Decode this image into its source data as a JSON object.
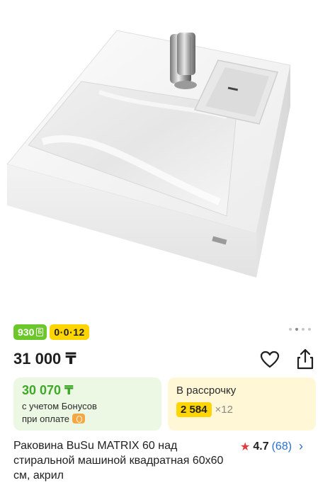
{
  "badges": {
    "bonus_value": "930",
    "bonus_symbol": "Б",
    "installment": "0·0·12"
  },
  "gallery": {
    "image_subject": "washbasin-product-photo",
    "dots_count": 4,
    "active_dot": 2
  },
  "price": {
    "main": "31 000 ₸"
  },
  "bonus_card": {
    "price": "30 070 ₸",
    "note_line1": "с учетом Бонусов",
    "note_line2": "при оплате"
  },
  "installment_card": {
    "label": "В рассрочку",
    "amount": "2 584",
    "months": "×12"
  },
  "product": {
    "title": "Раковина BuSu MATRIX 60 над стиральной машиной квадратная 60х60 см, акрил",
    "rating": "4.7",
    "reviews": "(68)"
  },
  "colors": {
    "bonus_green": "#6cc72b",
    "installment_yellow": "#ffd500",
    "rating_star": "#e23a3a",
    "link_blue": "#2a6fd6"
  }
}
